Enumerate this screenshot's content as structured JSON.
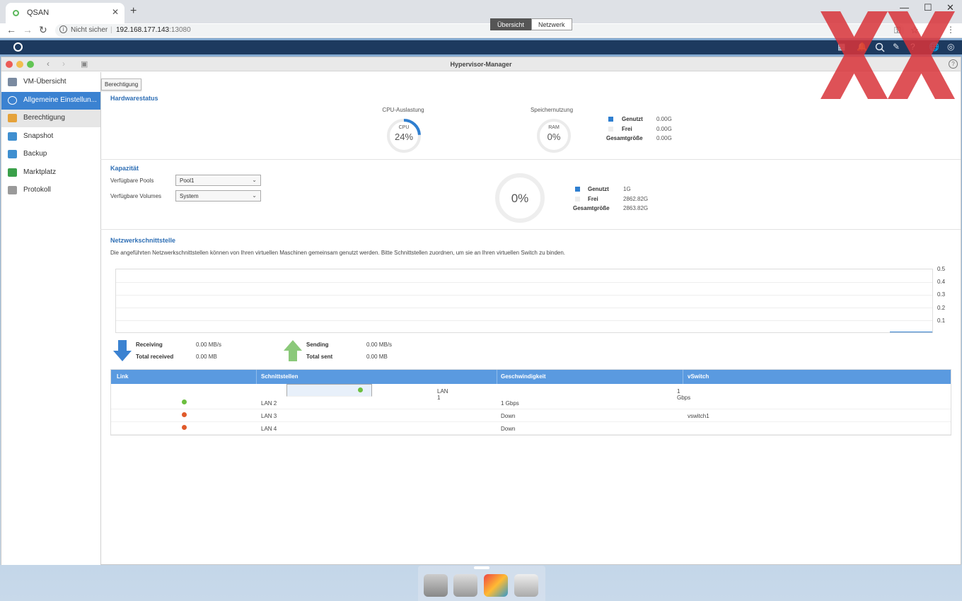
{
  "browser": {
    "tab_title": "QSAN",
    "tab_close": "✕",
    "new_tab": "+",
    "security_label": "Nicht sicher",
    "url_host": "192.168.177.143",
    "url_port": ":13080"
  },
  "window": {
    "title": "Hypervisor-Manager",
    "help": "?"
  },
  "sidebar": {
    "items": [
      {
        "label": "VM-Übersicht",
        "icon": "vm-overview-icon",
        "color": "#7a8aa0"
      },
      {
        "label": "Allgemeine Einstellun...",
        "icon": "settings-icon",
        "color": "#ffffff"
      },
      {
        "label": "Berechtigung",
        "icon": "permission-icon",
        "color": "#e5a23a"
      },
      {
        "label": "Snapshot",
        "icon": "snapshot-icon",
        "color": "#3f8fd0"
      },
      {
        "label": "Backup",
        "icon": "backup-icon",
        "color": "#3f8fd0"
      },
      {
        "label": "Marktplatz",
        "icon": "cart-icon",
        "color": "#3aa04a"
      },
      {
        "label": "Protokoll",
        "icon": "log-icon",
        "color": "#9a9a9a"
      }
    ],
    "tooltip": "Berechtigung"
  },
  "tabs": {
    "overview": "Übersicht",
    "network": "Netzwerk"
  },
  "hardware": {
    "title": "Hardwarestatus",
    "cpu_label": "CPU-Auslastung",
    "cpu_inner": "CPU",
    "cpu_value": "24%",
    "cpu_fraction": 0.24,
    "mem_label": "Speichernutzung",
    "mem_inner": "RAM",
    "mem_value": "0%",
    "legend": {
      "used_label": "Genutzt",
      "used_value": "0.00G",
      "free_label": "Frei",
      "free_value": "0.00G",
      "total_label": "Gesamtgröße",
      "total_value": "0.00G"
    }
  },
  "capacity": {
    "title": "Kapazität",
    "pools_label": "Verfügbare Pools",
    "pools_value": "Pool1",
    "volumes_label": "Verfügbare Volumes",
    "volumes_value": "System",
    "usage_value": "0%",
    "legend": {
      "used_label": "Genutzt",
      "used_value": "1G",
      "free_label": "Frei",
      "free_value": "2862.82G",
      "total_label": "Gesamtgröße",
      "total_value": "2863.82G"
    }
  },
  "network": {
    "title": "Netzwerkschnittstelle",
    "description": "Die angeführten Netzwerkschnittstellen können von Ihren virtuellen Maschinen gemeinsam genutzt werden. Bitte Schnittstellen zuordnen, um sie an Ihren virtuellen Switch zu binden.",
    "y_ticks": [
      "0.5",
      "0.4",
      "0.3",
      "0.2",
      "0.1"
    ],
    "receiving_label": "Receiving",
    "receiving_value": "0.00 MB/s",
    "total_received_label": "Total received",
    "total_received_value": "0.00 MB",
    "sending_label": "Sending",
    "sending_value": "0.00 MB/s",
    "total_sent_label": "Total sent",
    "total_sent_value": "0.00 MB"
  },
  "table": {
    "headers": [
      "Link",
      "Schnittstellen",
      "Geschwindigkeit",
      "vSwitch"
    ],
    "rows": [
      {
        "status": "up",
        "color": "#6cbf3f",
        "name": "LAN 1",
        "speed": "1 Gbps",
        "vswitch": ""
      },
      {
        "status": "up",
        "color": "#6cbf3f",
        "name": "LAN 2",
        "speed": "1 Gbps",
        "vswitch": ""
      },
      {
        "status": "down",
        "color": "#e05a2a",
        "name": "LAN 3",
        "speed": "Down",
        "vswitch": "vswitch1"
      },
      {
        "status": "down",
        "color": "#e05a2a",
        "name": "LAN 4",
        "speed": "Down",
        "vswitch": ""
      }
    ]
  },
  "colors": {
    "accent": "#3b82d1",
    "title_blue": "#2f6fb5",
    "used": "#2f7fd0"
  }
}
